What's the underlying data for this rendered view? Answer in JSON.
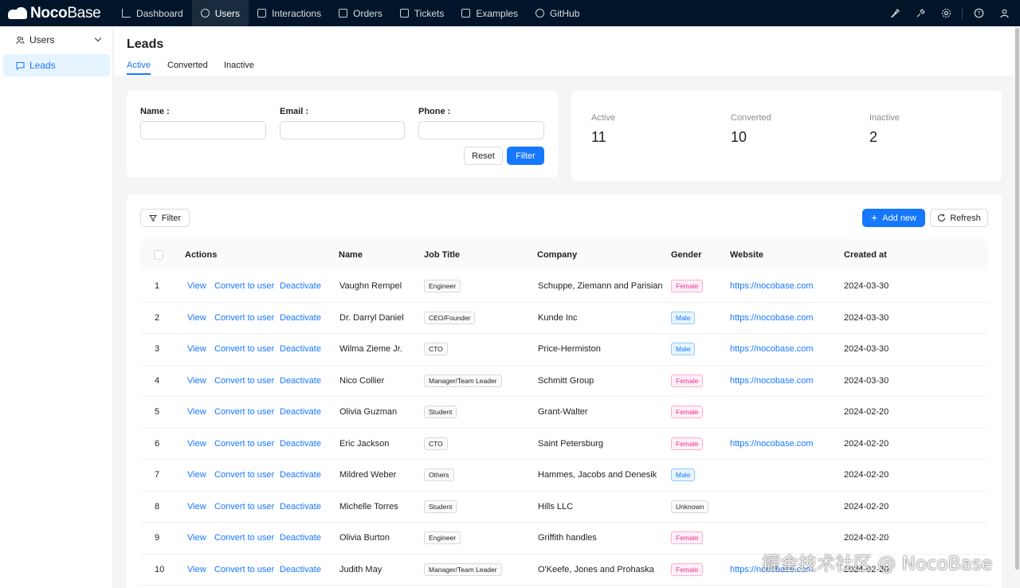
{
  "brand": {
    "bold": "Noco",
    "thin": "Base"
  },
  "nav": [
    {
      "label": "Dashboard",
      "icon": "bar-chart-icon"
    },
    {
      "label": "Users",
      "icon": "users-icon",
      "active": true
    },
    {
      "label": "Interactions",
      "icon": "calendar-icon"
    },
    {
      "label": "Orders",
      "icon": "order-icon"
    },
    {
      "label": "Tickets",
      "icon": "ticket-icon"
    },
    {
      "label": "Examples",
      "icon": "bank-icon"
    },
    {
      "label": "GitHub",
      "icon": "github-icon"
    }
  ],
  "sidebar": {
    "group": "Users",
    "items": [
      {
        "label": "Leads"
      }
    ]
  },
  "page": {
    "title": "Leads",
    "tabs": [
      "Active",
      "Converted",
      "Inactive"
    ]
  },
  "filter_form": {
    "name_label": "Name :",
    "email_label": "Email :",
    "phone_label": "Phone :",
    "reset": "Reset",
    "filter": "Filter"
  },
  "stats": [
    {
      "label": "Active",
      "value": "11"
    },
    {
      "label": "Converted",
      "value": "10"
    },
    {
      "label": "Inactive",
      "value": "2"
    }
  ],
  "toolbar": {
    "filter": "Filter",
    "add_new": "Add new",
    "refresh": "Refresh"
  },
  "table": {
    "columns": [
      "Actions",
      "Name",
      "Job Title",
      "Company",
      "Gender",
      "Website",
      "Created at"
    ],
    "actions": [
      "View",
      "Convert to user",
      "Deactivate"
    ],
    "rows": [
      {
        "no": "1",
        "name": "Vaughn Rempel",
        "job": "Engineer",
        "company": "Schuppe, Ziemann and Parisian",
        "gender": "Female",
        "website": "https://nocobase.com",
        "created": "2024-03-30"
      },
      {
        "no": "2",
        "name": "Dr. Darryl Daniel",
        "job": "CEO/Founder",
        "company": "Kunde Inc",
        "gender": "Male",
        "website": "https://nocobase.com",
        "created": "2024-03-30"
      },
      {
        "no": "3",
        "name": "Wilma Zieme Jr.",
        "job": "CTO",
        "company": "Price-Hermiston",
        "gender": "Male",
        "website": "https://nocobase.com",
        "created": "2024-03-30"
      },
      {
        "no": "4",
        "name": "Nico Collier",
        "job": "Manager/Team Leader",
        "company": "Schmitt Group",
        "gender": "Female",
        "website": "https://nocobase.com",
        "created": "2024-03-30"
      },
      {
        "no": "5",
        "name": "Olivia Guzman",
        "job": "Student",
        "company": "Grant-Walter",
        "gender": "Female",
        "website": "",
        "created": "2024-02-20"
      },
      {
        "no": "6",
        "name": "Eric Jackson",
        "job": "CTO",
        "company": "Saint Petersburg",
        "gender": "Female",
        "website": "https://nocobase.com",
        "created": "2024-02-20"
      },
      {
        "no": "7",
        "name": "Mildred Weber",
        "job": "Others",
        "company": "Hammes, Jacobs and Denesik",
        "gender": "Male",
        "website": "",
        "created": "2024-02-20"
      },
      {
        "no": "8",
        "name": "Michelle Torres",
        "job": "Student",
        "company": "Hills LLC",
        "gender": "Unknown",
        "website": "",
        "created": "2024-02-20"
      },
      {
        "no": "9",
        "name": "Olivia Burton",
        "job": "Engineer",
        "company": "Griffith handles",
        "gender": "Female",
        "website": "",
        "created": "2024-02-20"
      },
      {
        "no": "10",
        "name": "Judith May",
        "job": "Manager/Team Leader",
        "company": "O'Keefe, Jones and Prohaska",
        "gender": "Female",
        "website": "https://nocobase.com",
        "created": "2024-02-20"
      }
    ]
  },
  "watermark": "掘金技术社区 @ NocoBase"
}
